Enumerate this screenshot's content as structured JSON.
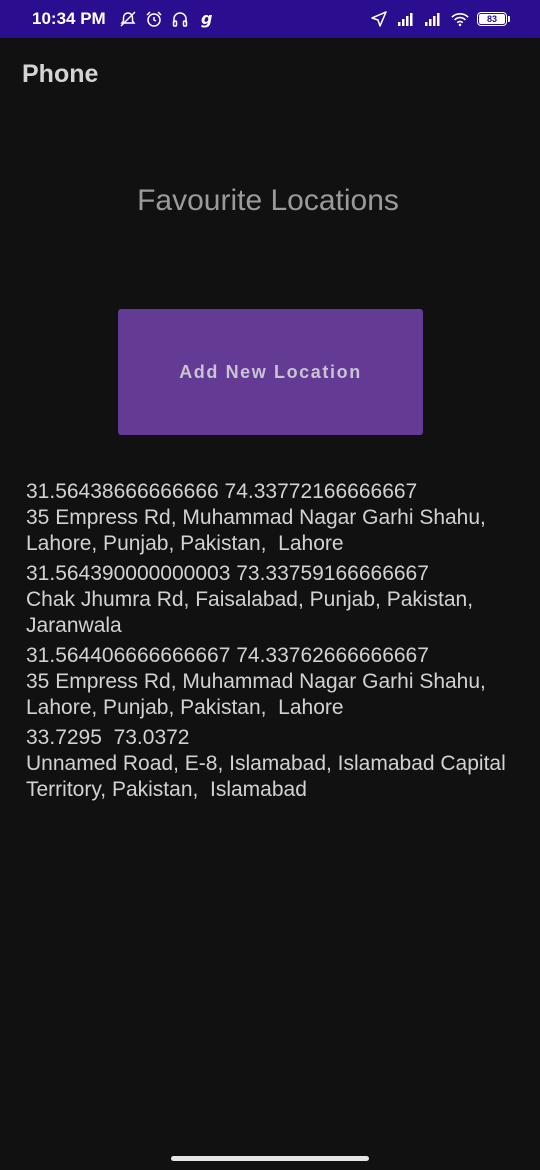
{
  "status_bar": {
    "time": "10:34 PM",
    "left_icons": [
      "muted-alarm-icon",
      "alarm-clock-icon",
      "headset-icon",
      "g-app-icon"
    ],
    "right_icons": [
      "location-arrow-icon",
      "signal-bars-icon",
      "signal-bars-icon",
      "wifi-icon"
    ],
    "battery_level": "83"
  },
  "app_bar": {
    "title": "Phone"
  },
  "main": {
    "heading": "Favourite Locations",
    "add_button_label": "Add New Location",
    "locations": [
      {
        "coords": "31.56438666666666 74.33772166666667",
        "address": "35 Empress Rd, Muhammad Nagar Garhi Shahu, Lahore, Punjab, Pakistan,  Lahore"
      },
      {
        "coords": "31.564390000000003 73.33759166666667",
        "address": "Chak Jhumra Rd, Faisalabad, Punjab, Pakistan, Jaranwala"
      },
      {
        "coords": "31.564406666666667 74.33762666666667",
        "address": "35 Empress Rd, Muhammad Nagar Garhi Shahu, Lahore, Punjab, Pakistan,  Lahore"
      },
      {
        "coords": "33.7295  73.0372",
        "address": "Unnamed Road, E-8, Islamabad, Islamabad Capital Territory, Pakistan,  Islamabad"
      }
    ]
  },
  "colors": {
    "status_bar": "#2a0e8f",
    "background": "#111111",
    "button": "#633a94",
    "text": "#d2d2d2"
  }
}
